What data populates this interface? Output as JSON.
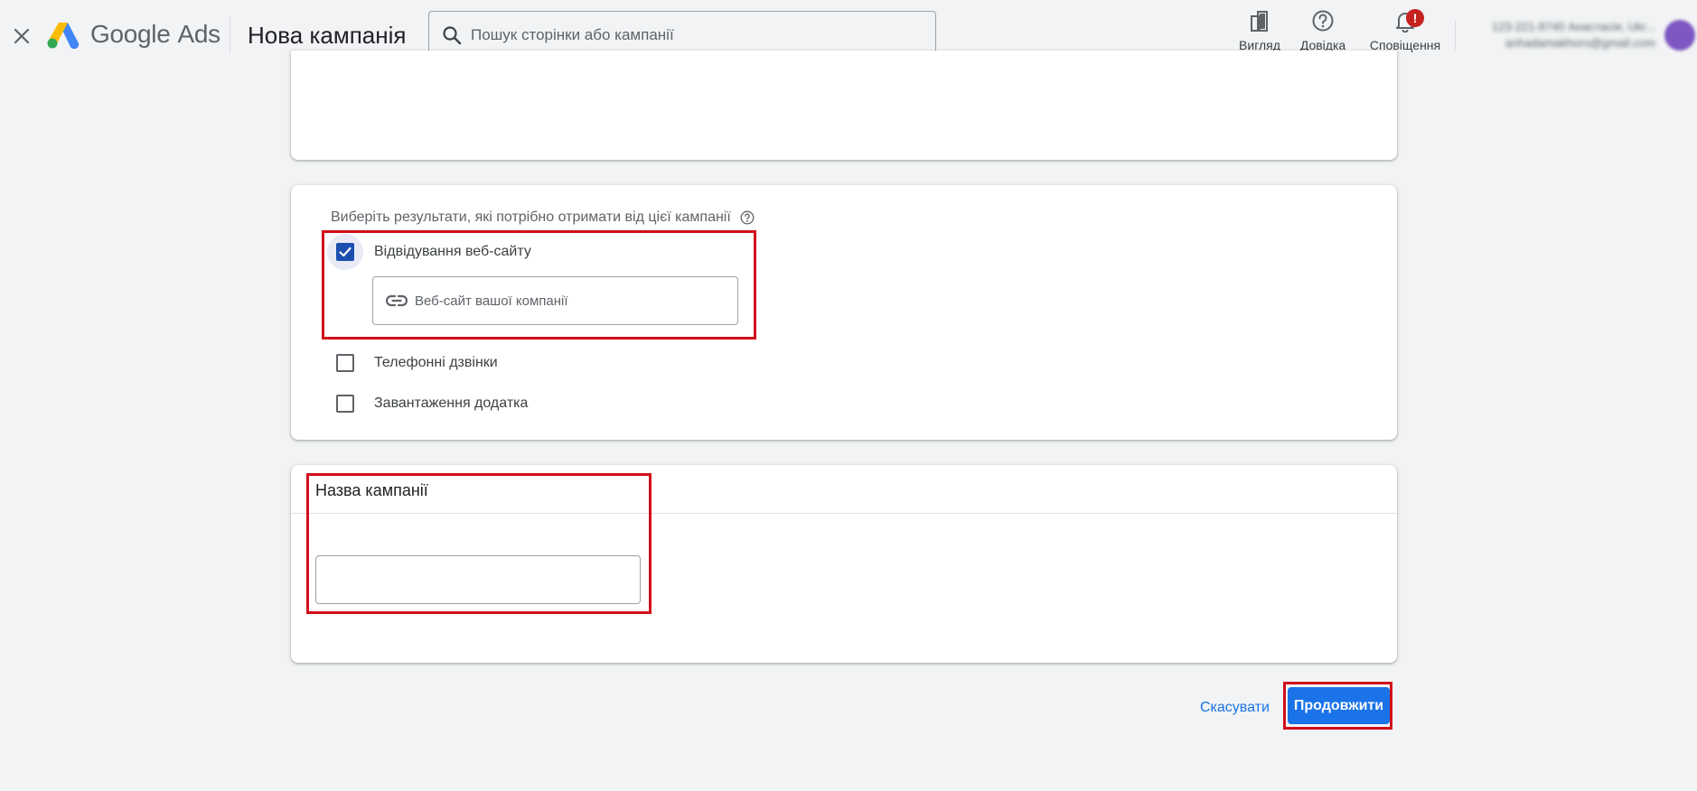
{
  "app": {
    "brand_google": "Google",
    "brand_ads": "Ads",
    "page_title": "Нова кампанія"
  },
  "search": {
    "placeholder": "Пошук сторінки або кампанії"
  },
  "top_actions": {
    "view_label": "Вигляд",
    "help_label": "Довідка",
    "notifications_label": "Сповіщення",
    "notifications_badge": "!"
  },
  "account": {
    "line1": "123-221-8740 Анастасія, Ukr...",
    "line2": "anhadamakhoro@gmail.com"
  },
  "results": {
    "heading": "Виберіть результати, які потрібно отримати від цієї кампанії",
    "options": [
      {
        "label": "Відвідування веб-сайту",
        "checked": true
      },
      {
        "label": "Телефонні дзвінки",
        "checked": false
      },
      {
        "label": "Завантаження додатка",
        "checked": false
      }
    ],
    "website_placeholder": "Веб-сайт вашої компанії"
  },
  "campaign_name": {
    "title": "Назва кампанії",
    "value": ""
  },
  "footer": {
    "cancel_label": "Скасувати",
    "continue_label": "Продовжити"
  },
  "colors": {
    "primary": "#1a73e8",
    "checkbox_checked": "#1b4fae",
    "highlight": "#d20f1a",
    "notification_badge": "#c5221f"
  }
}
